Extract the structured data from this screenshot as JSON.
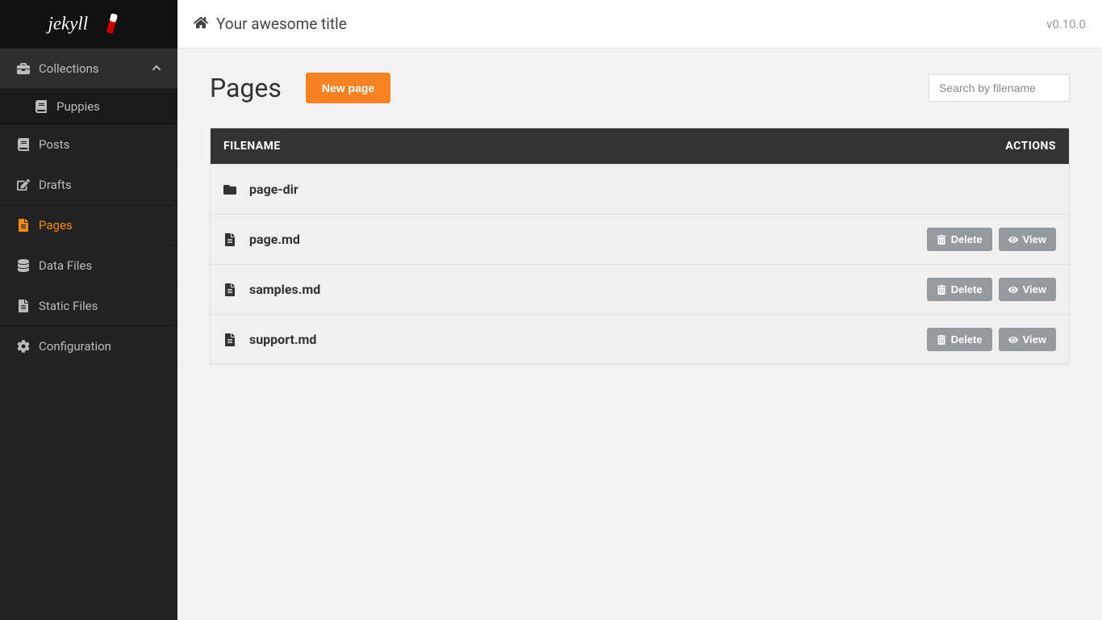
{
  "header": {
    "site_title": "Your awesome title",
    "version": "v0.10.0"
  },
  "sidebar": {
    "logo_alt": "jekyll",
    "items": [
      {
        "label": "Collections",
        "icon": "briefcase-icon",
        "expanded": true
      },
      {
        "label": "Puppies",
        "icon": "book-icon",
        "sub": true
      },
      {
        "label": "Posts",
        "icon": "book-icon"
      },
      {
        "label": "Drafts",
        "icon": "edit-icon"
      },
      {
        "label": "Pages",
        "icon": "file-icon",
        "active": true
      },
      {
        "label": "Data Files",
        "icon": "database-icon"
      },
      {
        "label": "Static Files",
        "icon": "file-icon"
      },
      {
        "label": "Configuration",
        "icon": "gear-icon"
      }
    ]
  },
  "page": {
    "title": "Pages",
    "new_button": "New page",
    "search_placeholder": "Search by filename"
  },
  "table": {
    "headers": {
      "filename": "FILENAME",
      "actions": "ACTIONS"
    },
    "delete_label": "Delete",
    "view_label": "View",
    "rows": [
      {
        "name": "page-dir",
        "type": "folder"
      },
      {
        "name": "page.md",
        "type": "file"
      },
      {
        "name": "samples.md",
        "type": "file"
      },
      {
        "name": "support.md",
        "type": "file"
      }
    ]
  }
}
